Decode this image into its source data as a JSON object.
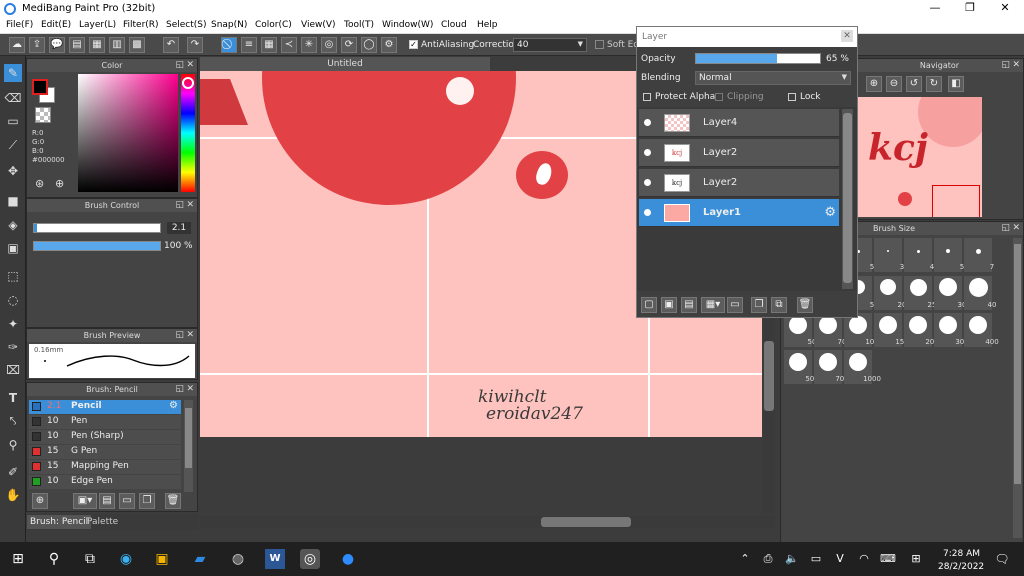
{
  "app": {
    "title": "MediBang Paint Pro (32bit)"
  },
  "window_controls": {
    "minimize": "—",
    "maximize": "❐",
    "close": "✕"
  },
  "menu": [
    "File(F)",
    "Edit(E)",
    "Layer(L)",
    "Filter(R)",
    "Select(S)",
    "Snap(N)",
    "Color(C)",
    "View(V)",
    "Tool(T)",
    "Window(W)",
    "Cloud",
    "Help"
  ],
  "toolbar": {
    "antialiasing_label": "AntiAliasing",
    "correction_label": "Correction",
    "correction_value": "40",
    "soft_edge_label": "Soft Ed"
  },
  "color_panel": {
    "title": "Color",
    "r": "R:0",
    "g": "G:0",
    "b": "B:0",
    "hex": "#000000",
    "colors": {
      "foreground": "#000000",
      "background": "#ffffff"
    }
  },
  "brush_control": {
    "title": "Brush Control",
    "size_value": "2.1",
    "opacity_value": "100 %"
  },
  "brush_preview": {
    "title": "Brush Preview",
    "size_readout": "0.16mm"
  },
  "brush_list": {
    "title": "Brush: Pencil",
    "items": [
      {
        "size": "2.1",
        "name": "Pencil",
        "color": "#3a8fd8"
      },
      {
        "size": "10",
        "name": "Pen",
        "color": "#333333"
      },
      {
        "size": "10",
        "name": "Pen (Sharp)",
        "color": "#333333"
      },
      {
        "size": "15",
        "name": "G Pen",
        "color": "#e03030"
      },
      {
        "size": "15",
        "name": "Mapping Pen",
        "color": "#e03030"
      },
      {
        "size": "10",
        "name": "Edge Pen",
        "color": "#20a020"
      }
    ]
  },
  "bottom_tabs": {
    "brush": "Brush: Pencil",
    "palette": "Palette"
  },
  "canvas": {
    "tab_title": "Untitled",
    "signature_line1": "kiwihclt",
    "signature_line2": "eroidav247",
    "colors": {
      "background": "#fec3bf",
      "circle": "#e24245",
      "grid": "#ffffff"
    }
  },
  "layer_panel": {
    "title": "Layer",
    "opacity_label": "Opacity",
    "opacity_value": "65 %",
    "opacity_fraction": 0.65,
    "blending_label": "Blending",
    "blending_value": "Normal",
    "protect_alpha": "Protect Alpha",
    "clipping": "Clipping",
    "lock": "Lock",
    "layers": [
      {
        "name": "Layer4",
        "thumb": ""
      },
      {
        "name": "Layer2",
        "thumb": "kcj"
      },
      {
        "name": "Layer2",
        "thumb": "kcj"
      },
      {
        "name": "Layer1",
        "thumb": ""
      }
    ]
  },
  "navigator": {
    "title": "Navigator",
    "thumb_text": "kcj"
  },
  "brush_size": {
    "title": "Brush Size",
    "sizes": [
      "3",
      "4",
      "5",
      "7",
      "20",
      "25",
      "30",
      "40",
      "70",
      "100",
      "150",
      "200",
      "300",
      "400",
      "500",
      "700",
      "1000"
    ],
    "partial": [
      "5",
      "50"
    ]
  },
  "taskbar": {
    "time": "7:28 AM",
    "date": "28/2/2022"
  }
}
